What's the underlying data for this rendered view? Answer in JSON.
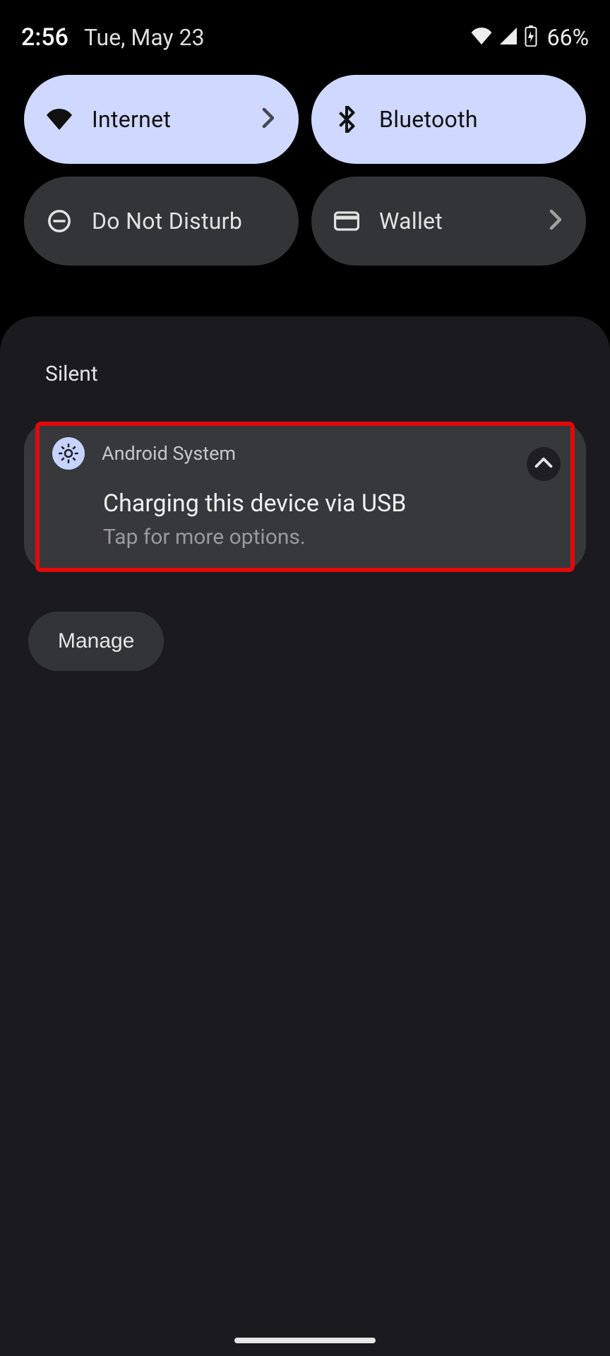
{
  "statusbar": {
    "time": "2:56",
    "date": "Tue, May 23",
    "battery": "66%"
  },
  "qs": {
    "internet": {
      "label": "Internet"
    },
    "bluetooth": {
      "label": "Bluetooth"
    },
    "dnd": {
      "label": "Do Not Disturb"
    },
    "wallet": {
      "label": "Wallet"
    }
  },
  "notifications": {
    "section": "Silent",
    "item": {
      "app": "Android System",
      "title": "Charging this device via USB",
      "body": "Tap for more options."
    },
    "manage": "Manage"
  }
}
